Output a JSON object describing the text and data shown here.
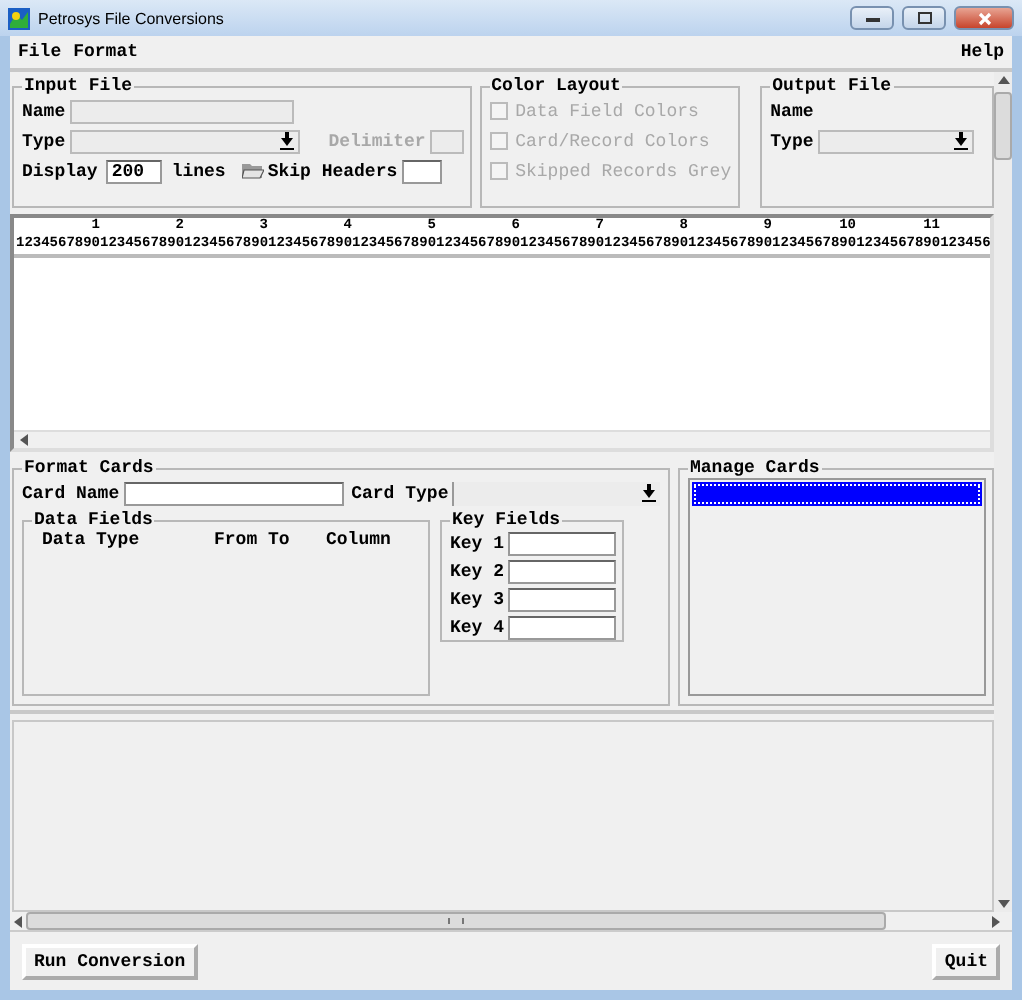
{
  "window": {
    "title": "Petrosys File Conversions"
  },
  "menu": [
    {
      "label": "File"
    },
    {
      "label": "Format"
    },
    {
      "label": "Help"
    }
  ],
  "input_file": {
    "title": "Input File",
    "name_label": "Name",
    "type_label": "Type",
    "delimiter": {
      "label": "Delimiter",
      "disabled": true
    },
    "display_label": "Display",
    "display_value": "200",
    "lines_label": "lines",
    "skip_headers_label": "Skip Headers"
  },
  "color_layout": {
    "title": "Color Layout",
    "options": [
      {
        "label": "Data Field Colors",
        "checked": false,
        "disabled": true
      },
      {
        "label": "Card/Record Colors",
        "checked": false,
        "disabled": true
      },
      {
        "label": "Skipped Records Grey",
        "checked": false,
        "disabled": true
      }
    ]
  },
  "output_file": {
    "title": "Output File",
    "name_label": "Name",
    "type_label": "Type"
  },
  "ruler": {
    "ticks": [
      "1",
      "2",
      "3",
      "4",
      "5",
      "6",
      "7",
      "8",
      "9",
      "10",
      "11"
    ],
    "digits": "12345678901234567890123456789012345678901234567890123456789012345678901234567890123456789012345678901234567890123456"
  },
  "format_cards": {
    "title": "Format Cards",
    "card_name_label": "Card Name",
    "card_type_label": "Card Type",
    "data_fields": {
      "title": "Data Fields",
      "columns": [
        "Data Type",
        "From To",
        "Column"
      ]
    },
    "key_fields": {
      "title": "Key Fields",
      "keys": [
        "Key 1",
        "Key 2",
        "Key 3",
        "Key 4"
      ]
    }
  },
  "manage_cards": {
    "title": "Manage Cards",
    "items": [
      {
        "selected": true
      }
    ]
  },
  "buttons": [
    {
      "label": "Run Conversion"
    },
    {
      "label": "Quit"
    }
  ]
}
